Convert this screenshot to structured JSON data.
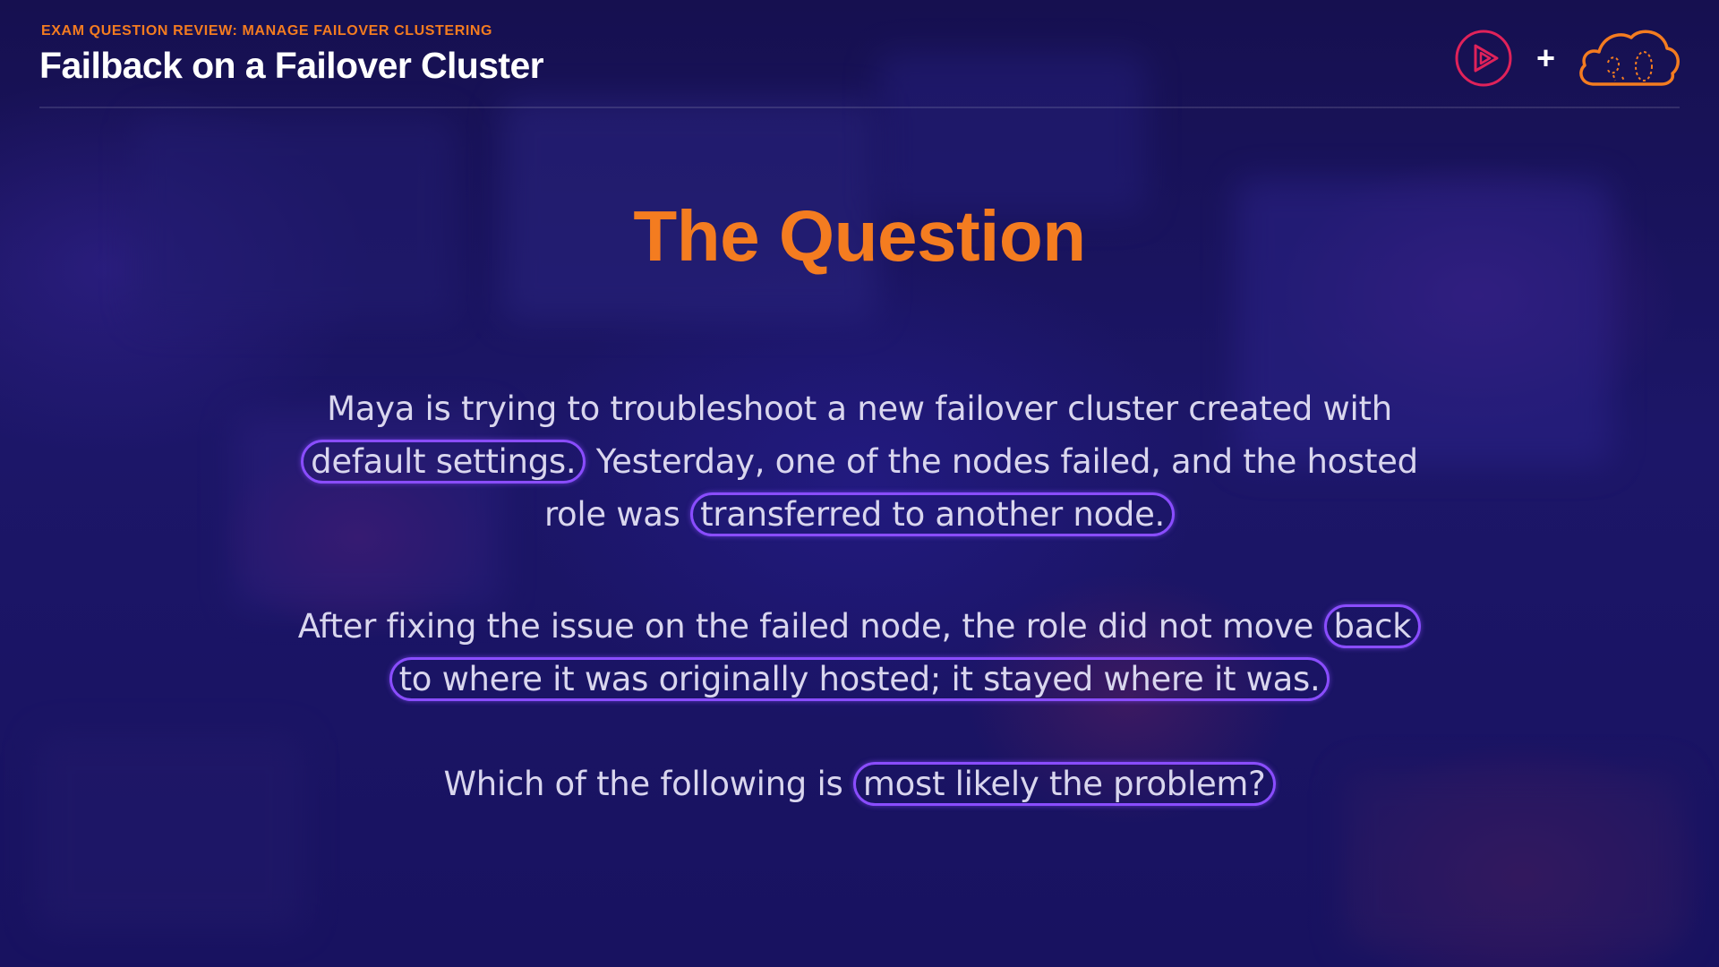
{
  "header": {
    "kicker": "EXAM QUESTION REVIEW: MANAGE FAILOVER CLUSTERING",
    "title": "Failback on a Failover Cluster",
    "plus": "+"
  },
  "icons": {
    "play_logo": "play-circle-icon",
    "cloud_logo": "cloud-icon"
  },
  "colors": {
    "accent_orange": "#f47c20",
    "highlight_purple": "#8a4dff",
    "logo_red": "#e0225a"
  },
  "slide": {
    "heading": "The Question",
    "para1": {
      "t1": "Maya is trying to troubleshoot a new failover cluster created with ",
      "h1": "default settings.",
      "t2": " Yesterday, one of the nodes failed, and the hosted role was ",
      "h2": "transferred to another node."
    },
    "para2": {
      "t1": "After fixing the issue on the failed node, the role did not move ",
      "h1": "back to where it was originally hosted; it stayed where it was."
    },
    "para3": {
      "t1": "Which of the following is ",
      "h1": "most likely the problem?"
    }
  }
}
